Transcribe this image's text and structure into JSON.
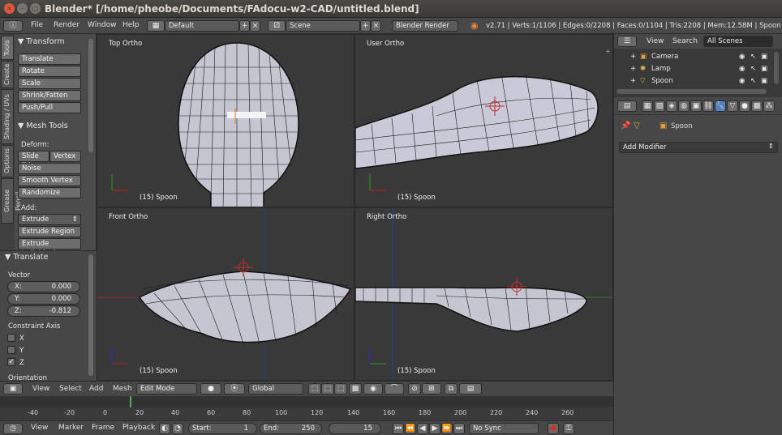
{
  "window": {
    "title": "Blender* [/home/pheobe/Documents/FAdocu-w2-CAD/untitled.blend]"
  },
  "info_header": {
    "menus": [
      "File",
      "Render",
      "Window",
      "Help"
    ],
    "layout": "Default",
    "scene": "Scene",
    "engine": "Blender Render",
    "stats": "v2.71 | Verts:1/1106 | Edges:0/2208 | Faces:0/1104 | Tris:2208 | Mem:12.58M | Spoon"
  },
  "tool_shelf": {
    "tabs": [
      "Tools",
      "Create",
      "Shading / UVs",
      "Options",
      "Grease Pencil"
    ],
    "transform": {
      "title": "Transform",
      "buttons": [
        "Translate",
        "Rotate",
        "Scale",
        "Shrink/Fatten",
        "Push/Pull"
      ]
    },
    "mesh_tools": {
      "title": "Mesh Tools",
      "deform_label": "Deform:",
      "deform_row": [
        "Slide Ed",
        "Vertex"
      ],
      "buttons": [
        "Noise",
        "Smooth Vertex",
        "Randomize"
      ],
      "add_label": "Add:",
      "extrude": "Extrude",
      "add_buttons": [
        "Extrude Region",
        "Extrude Individual"
      ]
    },
    "operator": {
      "title": "Translate",
      "vector_label": "Vector",
      "x": {
        "label": "X:",
        "value": "0.000"
      },
      "y": {
        "label": "Y:",
        "value": "0.000"
      },
      "z": {
        "label": "Z:",
        "value": "-0.812"
      },
      "constraint_label": "Constraint Axis",
      "axes": [
        {
          "label": "X",
          "checked": false
        },
        {
          "label": "Y",
          "checked": false
        },
        {
          "label": "Z",
          "checked": true
        }
      ],
      "orientation_label": "Orientation"
    }
  },
  "viewports": [
    {
      "label": "Top Ortho",
      "object": "(15) Spoon"
    },
    {
      "label": "User Ortho",
      "object": "(15) Spoon"
    },
    {
      "label": "Front Ortho",
      "object": "(15) Spoon"
    },
    {
      "label": "Right Ortho",
      "object": "(15) Spoon"
    }
  ],
  "view3d_header": {
    "menus": [
      "View",
      "Select",
      "Add",
      "Mesh"
    ],
    "mode": "Edit Mode",
    "orientation": "Global"
  },
  "timeline": {
    "ticks": [
      "-40",
      "-20",
      "0",
      "20",
      "40",
      "60",
      "80",
      "100",
      "120",
      "140",
      "160",
      "180",
      "200",
      "220",
      "240",
      "260"
    ],
    "current_frame": 15,
    "menus": [
      "View",
      "Marker",
      "Frame",
      "Playback"
    ],
    "start_label": "Start:",
    "start": "1",
    "end_label": "End:",
    "end": "250",
    "frame": "15",
    "sync": "No Sync"
  },
  "outliner": {
    "menus": [
      "View",
      "Search"
    ],
    "filter": "All Scenes",
    "items": [
      {
        "label": "Camera"
      },
      {
        "label": "Lamp"
      },
      {
        "label": "Spoon"
      }
    ]
  },
  "properties": {
    "object": "Spoon",
    "add_modifier": "Add Modifier"
  },
  "colors": {
    "accent": "#5680c2",
    "header": "#474747",
    "viewport": "#393939",
    "mesh_fill": "#c9c9d8"
  }
}
